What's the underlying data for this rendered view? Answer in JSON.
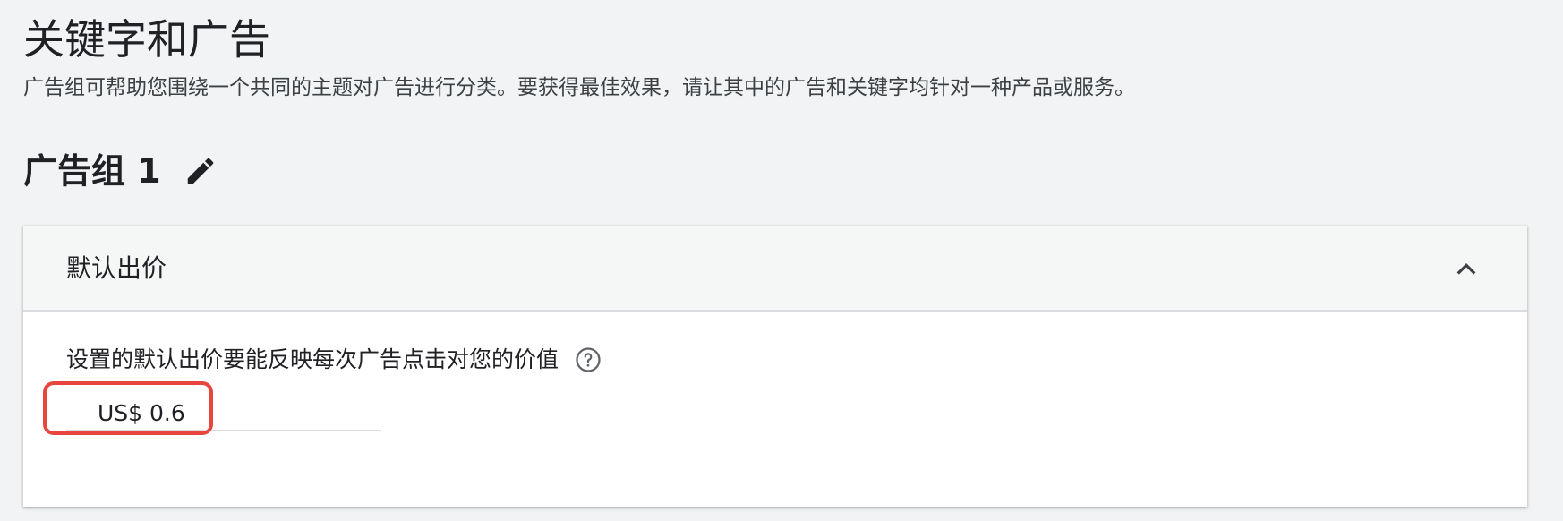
{
  "page": {
    "title": "关键字和广告",
    "description": "广告组可帮助您围绕一个共同的主题对广告进行分类。要获得最佳效果，请让其中的广告和关键字均针对一种产品或服务。"
  },
  "ad_group": {
    "name": "广告组 1",
    "edit_icon": "pencil-icon"
  },
  "default_bid_panel": {
    "title": "默认出价",
    "state": "expanded",
    "collapse_icon": "chevron-up-icon",
    "bid_label": "设置的默认出价要能反映每次广告点击对您的价值",
    "help_icon": "help-circle-icon",
    "bid_value": "US$ 0.6"
  },
  "colors": {
    "background": "#f1f3f4",
    "panel_header": "#f5f6f6",
    "text": "#202124",
    "highlight": "#e8453c",
    "divider": "#dadce0"
  }
}
